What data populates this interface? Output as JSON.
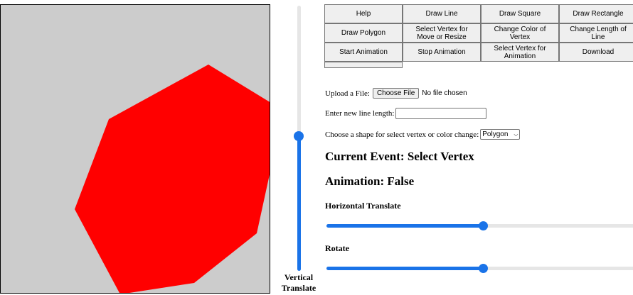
{
  "canvas": {
    "background": "#cccccc",
    "shape": {
      "name": "Polygon",
      "fill": "#ff0000"
    }
  },
  "vertical_slider": {
    "label_line1": "Vertical",
    "label_line2": "Translate",
    "value_fraction": 0.52
  },
  "buttons": [
    "Help",
    "Draw Line",
    "Draw Square",
    "Draw Rectangle",
    "Draw Polygon",
    "Select Vertex for Move or Resize",
    "Change Color of Vertex",
    "Change Length of Line",
    "Start Animation",
    "Stop Animation",
    "Select Vertex for Animation",
    "Download"
  ],
  "upload": {
    "label": "Upload a File:",
    "button": "Choose File",
    "status": "No file chosen"
  },
  "line_length": {
    "label": "Enter new line length:",
    "value": ""
  },
  "shape_select": {
    "label": "Choose a shape for select vertex or color change:",
    "selected": "Polygon"
  },
  "current_event": "Current Event: Select Vertex",
  "animation": "Animation: False",
  "horizontal_translate": {
    "label": "Horizontal Translate",
    "value_fraction": 0.5
  },
  "rotate": {
    "label": "Rotate",
    "value_fraction": 0.5
  },
  "accent_color": "#1a73e8"
}
